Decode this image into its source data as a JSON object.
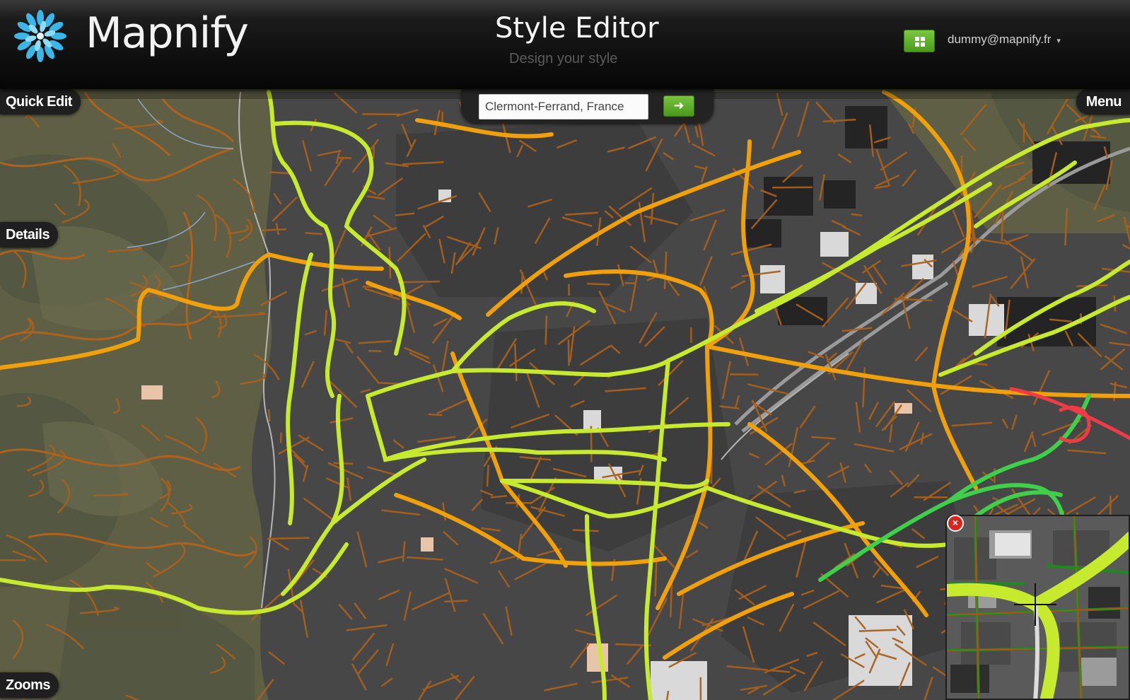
{
  "header": {
    "brand": "Mapnify",
    "title": "Style Editor",
    "subtitle": "Design your style",
    "user_email": "dummy@mapnify.fr",
    "user_menu_caret": "▾"
  },
  "search": {
    "value": "Clermont-Ferrand, France",
    "go_icon": "arrow-right-icon",
    "go_label": "➜"
  },
  "panels": {
    "quick_edit": "Quick Edit",
    "details": "Details",
    "zooms": "Zooms",
    "menu": "Menu"
  },
  "minimap": {
    "close_label": "×"
  },
  "colors": {
    "accent_green": "#5aad27",
    "logo_blue": "#36b3e6",
    "road_orange": "#f0a30a",
    "road_brown": "#b5651d",
    "road_yellowgreen": "#c6e82e",
    "road_green": "#3fd24a",
    "road_red": "#ee3b46",
    "terrain": "#5e5f44",
    "urban": "#434343"
  }
}
